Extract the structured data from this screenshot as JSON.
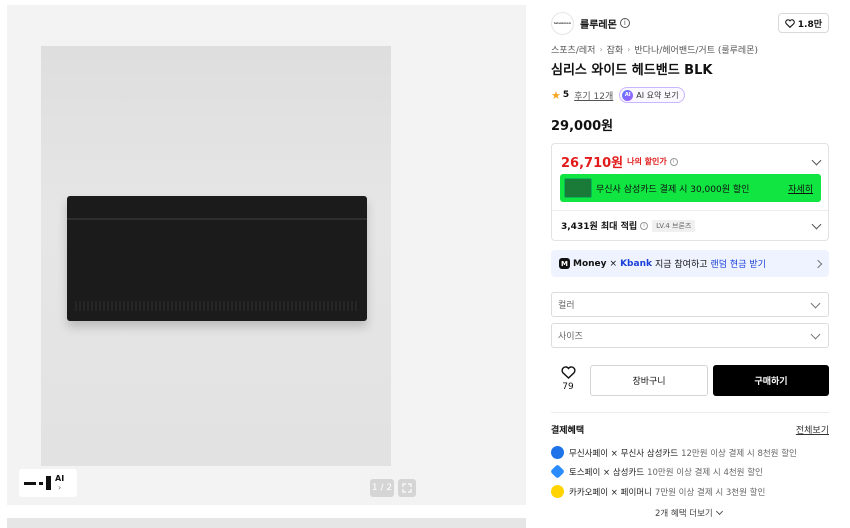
{
  "gallery": {
    "thumb_label": "AI",
    "pager": "1 / 2"
  },
  "brand": {
    "logo_text": "lululemon",
    "name": "룰루레몬",
    "likes": "1.8만"
  },
  "breadcrumb": [
    "스포츠/레저",
    "잡화",
    "반다나/헤어밴드/거트 (룰루레몬)"
  ],
  "product": {
    "title": "심리스 와이드 헤드밴드 BLK",
    "rating": "5",
    "reviews": "후기 12개",
    "ai_summary": "AI 요약 보기",
    "price": "29,000원"
  },
  "discount": {
    "price": "26,710원",
    "label": "나의 할인가",
    "card_text": "무신사 삼성카드 결제 시 30,000원 할인",
    "detail": "자세히",
    "points": "3,431원 최대 적립",
    "level": "LV.4 브론즈"
  },
  "money_banner": {
    "money": "Money",
    "times": "×",
    "kbank": "Kbank",
    "text": "지금 참여하고",
    "highlight": "랜덤 현금 받기"
  },
  "options": {
    "color_placeholder": "컬러",
    "size_placeholder": "사이즈"
  },
  "actions": {
    "wish_count": "79",
    "cart": "장바구니",
    "buy": "구매하기"
  },
  "benefits": {
    "title": "결제혜택",
    "view_all": "전체보기",
    "items": [
      {
        "name": "무신사페이 × 무신사 삼성카드",
        "desc": "12만원 이상 결제 시 8천원 할인",
        "color": "#1e73e8"
      },
      {
        "name": "토스페이 × 삼성카드",
        "desc": "10만원 이상 결제 시 4천원 할인",
        "color": "#2a8cff"
      },
      {
        "name": "카카오페이 × 페이머니",
        "desc": "7만원 이상 결제 시 3천원 할인",
        "color": "#ffd400"
      }
    ],
    "more": "2개 혜택 더보기"
  }
}
